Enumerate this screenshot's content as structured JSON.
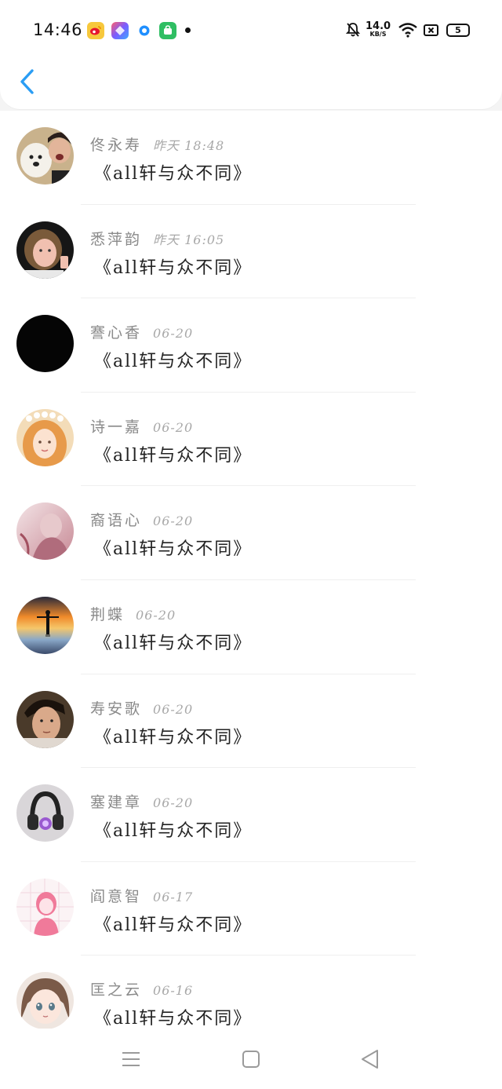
{
  "status_bar": {
    "time": "14:46",
    "net_speed_value": "14.0",
    "net_speed_unit": "KB/S",
    "battery": "5",
    "app_icons": [
      "weibo-icon",
      "pinwheel-app-icon",
      "blue-ring-app-icon",
      "green-shopping-app-icon"
    ],
    "indicator_icons": [
      "bell-muted-icon",
      "wifi-icon",
      "sim-disabled-icon",
      "battery-icon"
    ]
  },
  "header": {
    "back_icon": "chevron-left-icon",
    "accent_color": "#2a9df4"
  },
  "messages": [
    {
      "name": "佟永寿",
      "date": "昨天 18:48",
      "text": "《all轩与众不同》",
      "avatar": "dog-selfie"
    },
    {
      "name": "悉萍韵",
      "date": "昨天 16:05",
      "text": "《all轩与众不同》",
      "avatar": "curly-hair"
    },
    {
      "name": "謇心香",
      "date": "06-20",
      "text": "《all轩与众不同》",
      "avatar": "black"
    },
    {
      "name": "诗一嘉",
      "date": "06-20",
      "text": "《all轩与众不同》",
      "avatar": "flower-crown"
    },
    {
      "name": "裔语心",
      "date": "06-20",
      "text": "《all轩与众不同》",
      "avatar": "pink-blur"
    },
    {
      "name": "荆蝶",
      "date": "06-20",
      "text": "《all轩与众不同》",
      "avatar": "sunset-silhouette"
    },
    {
      "name": "寿安歌",
      "date": "06-20",
      "text": "《all轩与众不同》",
      "avatar": "man-portrait"
    },
    {
      "name": "塞建章",
      "date": "06-20",
      "text": "《all轩与众不同》",
      "avatar": "headphones"
    },
    {
      "name": "阎意智",
      "date": "06-17",
      "text": "《all轩与众不同》",
      "avatar": "pink-cartoon-girl"
    },
    {
      "name": "匡之云",
      "date": "06-16",
      "text": "《all轩与众不同》",
      "avatar": "anime-girl"
    }
  ],
  "nav_bar": {
    "icons": [
      "menu-icon",
      "home-square-icon",
      "back-triangle-icon"
    ]
  }
}
